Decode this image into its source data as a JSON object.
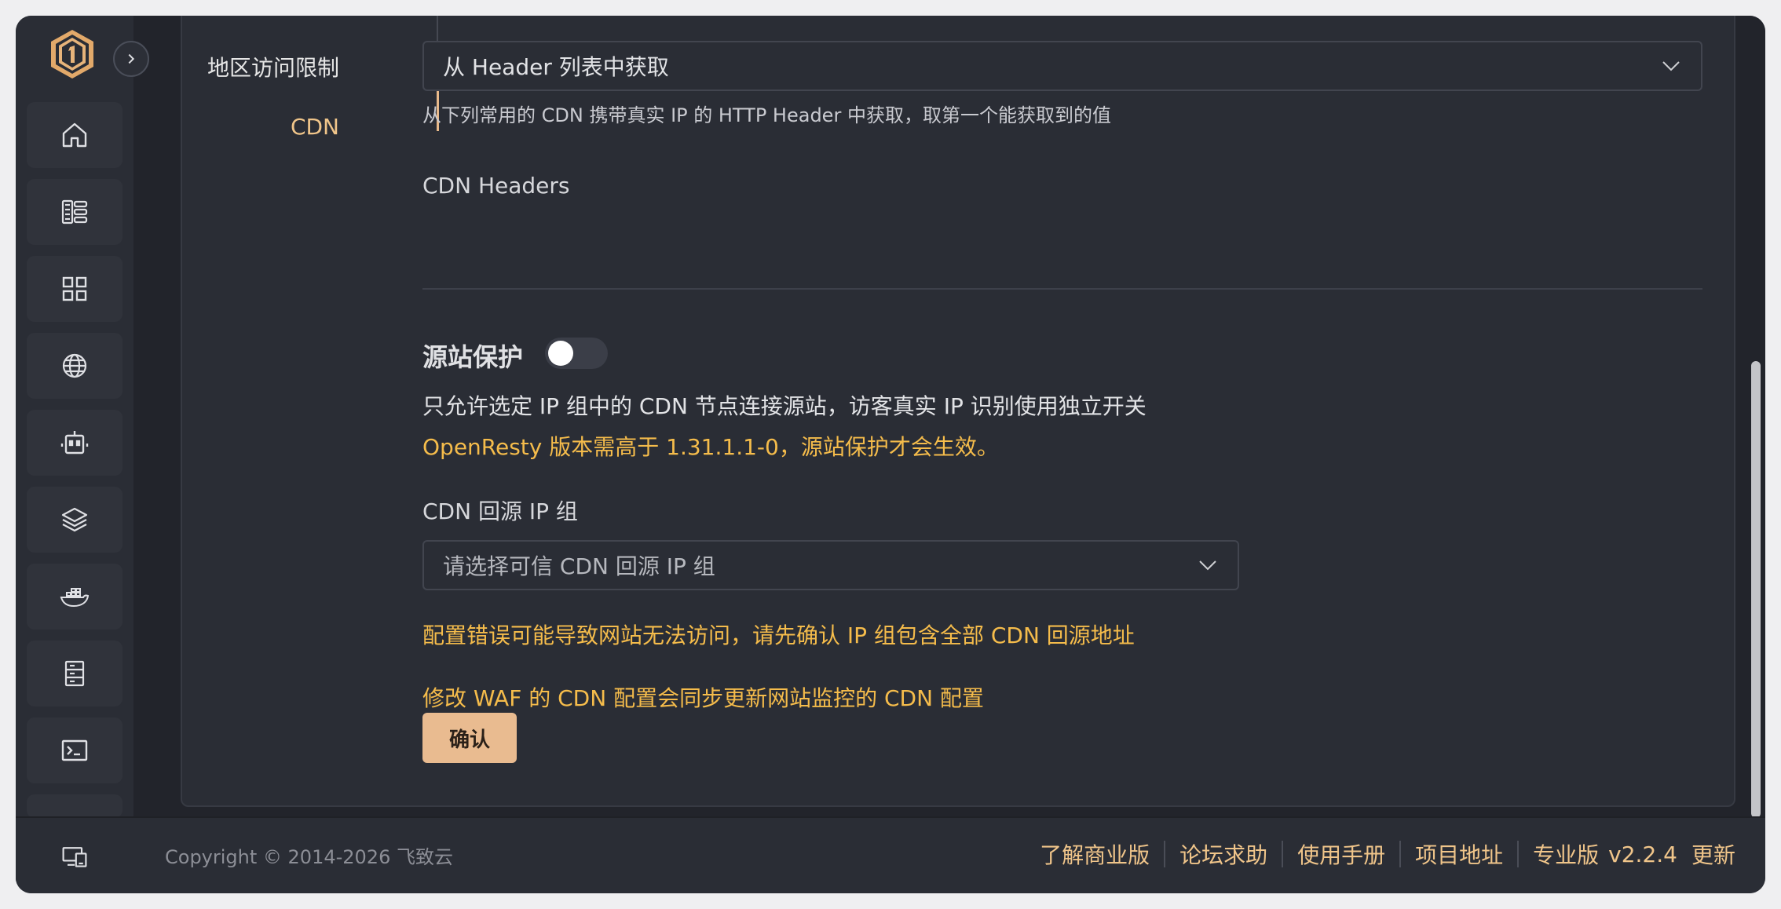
{
  "sidebar": {
    "items": [
      {
        "icon": "home-icon"
      },
      {
        "icon": "server-list-icon"
      },
      {
        "icon": "apps-grid-icon"
      },
      {
        "icon": "globe-icon"
      },
      {
        "icon": "robot-icon"
      },
      {
        "icon": "layers-icon"
      },
      {
        "icon": "docker-icon"
      },
      {
        "icon": "file-cabinet-icon"
      },
      {
        "icon": "terminal-icon"
      }
    ]
  },
  "tabs": [
    {
      "label": "地区访问限制",
      "active": false
    },
    {
      "label": "CDN",
      "active": true
    }
  ],
  "ip_source": {
    "selected": "从 Header 列表中获取",
    "hint": "从下列常用的 CDN 携带真实 IP 的 HTTP Header 中获取，取第一个能获取到的值"
  },
  "cdn_headers": {
    "label": "CDN Headers"
  },
  "origin_protection": {
    "title": "源站保护",
    "enabled": false,
    "description": "只允许选定 IP 组中的 CDN 节点连接源站，访客真实 IP 识别使用独立开关",
    "version_warning": "OpenResty 版本需高于 1.31.1.1-0，源站保护才会生效。",
    "ip_group_label": "CDN 回源 IP 组",
    "ip_group_placeholder": "请选择可信 CDN 回源 IP 组",
    "config_warning": "配置错误可能导致网站无法访问，请先确认 IP 组包含全部 CDN 回源地址",
    "sync_warning": "修改 WAF 的 CDN 配置会同步更新网站监控的 CDN 配置",
    "confirm_label": "确认"
  },
  "footer": {
    "copyright": "Copyright © 2014-2026 飞致云",
    "links": [
      "了解商业版",
      "论坛求助",
      "使用手册",
      "项目地址",
      "专业版"
    ],
    "version": "v2.2.4",
    "update_label": "更新"
  },
  "colors": {
    "accent": "#f0c58a",
    "warning": "#f5bc4b",
    "button": "#e9bb90",
    "background": "#22242b",
    "panel": "#2a2d35"
  }
}
